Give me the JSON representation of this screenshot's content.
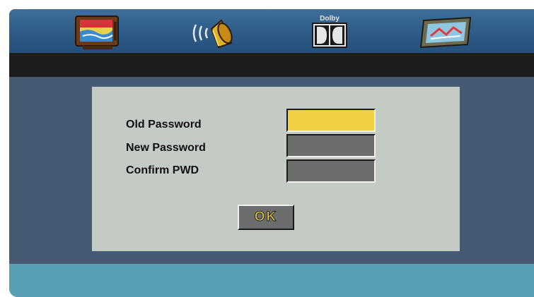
{
  "menu_tabs": [
    {
      "name": "picture-tv-icon"
    },
    {
      "name": "audio-speaker-icon"
    },
    {
      "name": "dolby-digital-icon",
      "label": "Dolby"
    },
    {
      "name": "preference-icon"
    }
  ],
  "dialog": {
    "fields": [
      {
        "label": "Old Password",
        "value": "",
        "focused": true
      },
      {
        "label": "New Password",
        "value": "",
        "focused": false
      },
      {
        "label": "Confirm PWD",
        "value": "",
        "focused": false
      }
    ],
    "ok_label": "OK"
  },
  "colors": {
    "topbar": "#2d5a86",
    "darkbar": "#1e1c1d",
    "background": "#475a73",
    "dialog": "#c3cbc4",
    "field_focused": "#f2d043",
    "field_default": "#6b6e6d",
    "footbar": "#57a0b4",
    "ok_text": "#f5d23a"
  }
}
